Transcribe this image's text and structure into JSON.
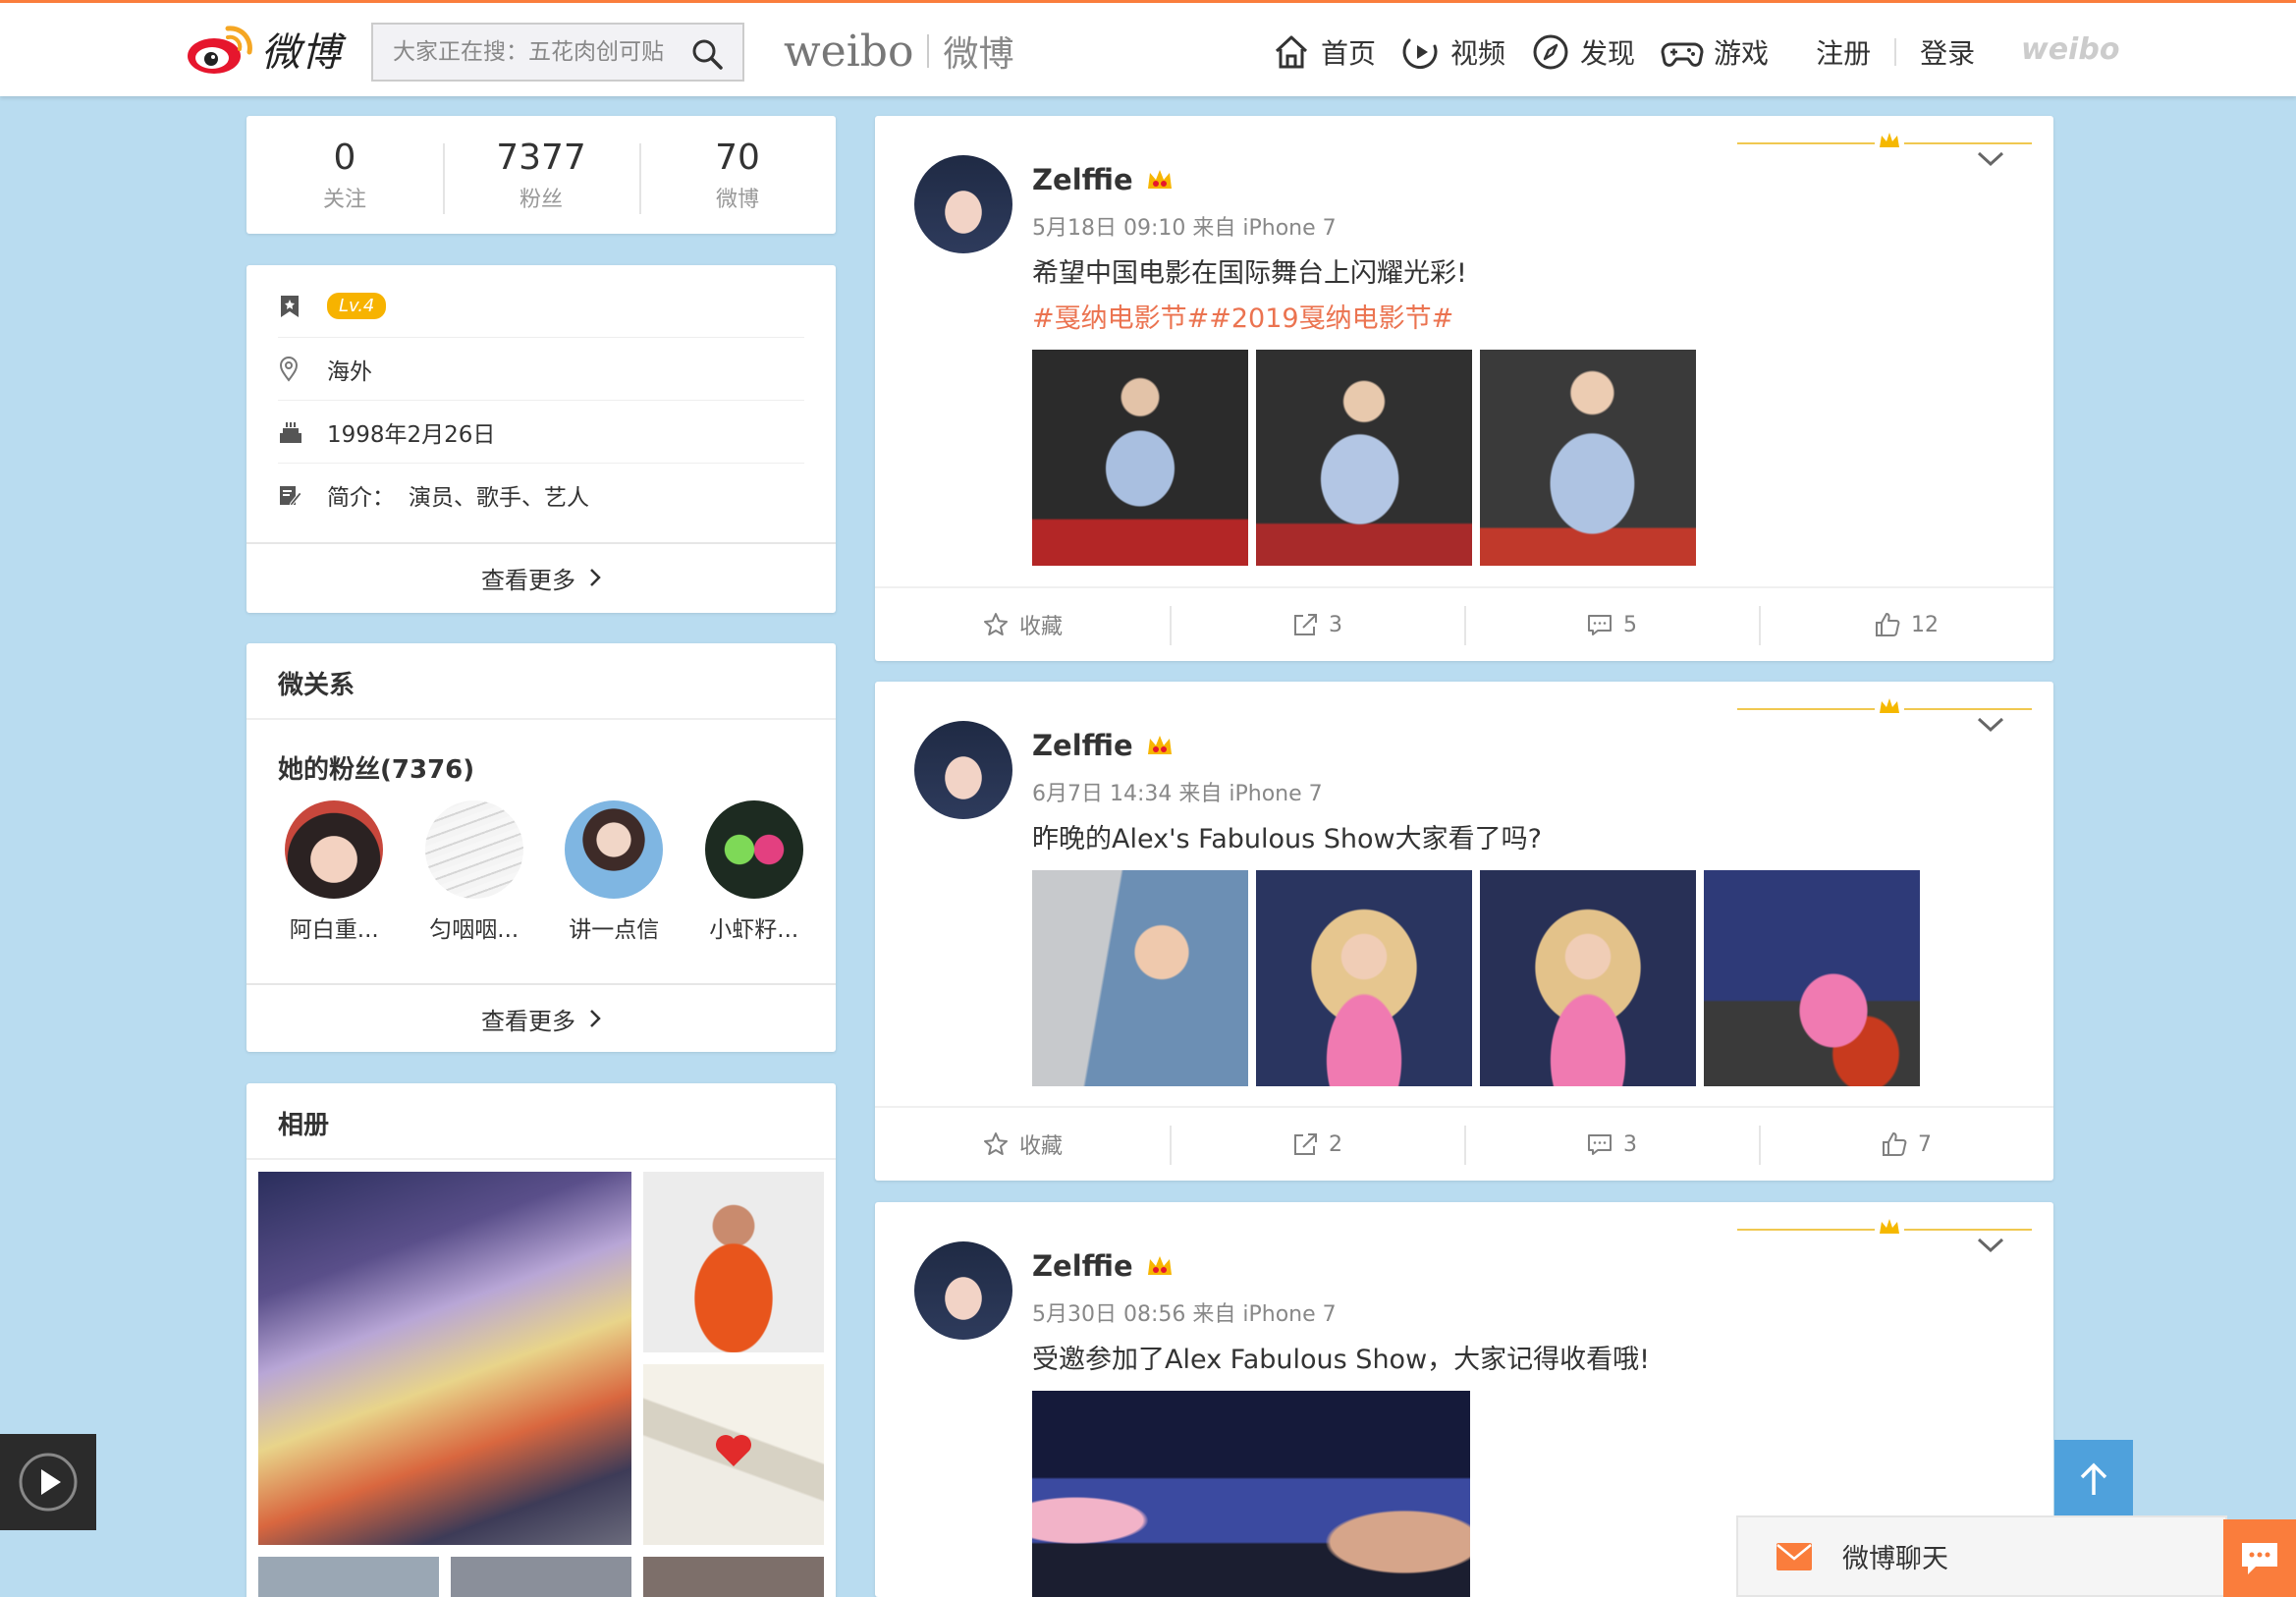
{
  "header": {
    "logo_text": "微博",
    "search_placeholder": "大家正在搜：五花肉创可贴",
    "brand_en": "weibo",
    "brand_cn": "微博",
    "nav": [
      {
        "label": "首页",
        "icon": "home-icon"
      },
      {
        "label": "视频",
        "icon": "video-icon"
      },
      {
        "label": "发现",
        "icon": "compass-icon"
      },
      {
        "label": "游戏",
        "icon": "gamepad-icon"
      }
    ],
    "register": "注册",
    "login": "登录",
    "small_logo": "weibo"
  },
  "profile": {
    "stats": [
      {
        "num": "0",
        "label": "关注"
      },
      {
        "num": "7377",
        "label": "粉丝"
      },
      {
        "num": "70",
        "label": "微博"
      }
    ],
    "level": "Lv.4",
    "location": "海外",
    "birthday": "1998年2月26日",
    "bio_label": "简介：",
    "bio": "演员、歌手、艺人",
    "more": "查看更多"
  },
  "relations": {
    "title": "微关系",
    "fans_title": "她的粉丝(7376)",
    "fans": [
      {
        "name": "阿白重..."
      },
      {
        "name": "匀咽咽..."
      },
      {
        "name": "讲一点信"
      },
      {
        "name": "小虾籽..."
      }
    ],
    "more": "查看更多"
  },
  "album": {
    "title": "相册"
  },
  "posts": [
    {
      "name": "Zelffie",
      "meta": "5月18日 09:10 来自 iPhone 7",
      "text": "希望中国电影在国际舞台上闪耀光彩!",
      "tag": "#戛纳电影节##2019戛纳电影节#",
      "actions": {
        "fav": "收藏",
        "repost": "3",
        "comment": "5",
        "like": "12"
      }
    },
    {
      "name": "Zelffie",
      "meta": "6月7日 14:34 来自 iPhone 7",
      "text": "昨晚的Alex's Fabulous Show大家看了吗?",
      "actions": {
        "fav": "收藏",
        "repost": "2",
        "comment": "3",
        "like": "7"
      }
    },
    {
      "name": "Zelffie",
      "meta": "5月30日 08:56 来自 iPhone 7",
      "text": "受邀参加了Alex Fabulous Show，大家记得收看哦!"
    }
  ],
  "chat": {
    "label": "微博聊天"
  },
  "colors": {
    "accent": "#fa7d3c",
    "tag": "#eb7350",
    "page_bg": "#b9dcf0",
    "to_top": "#4fa1dc"
  }
}
